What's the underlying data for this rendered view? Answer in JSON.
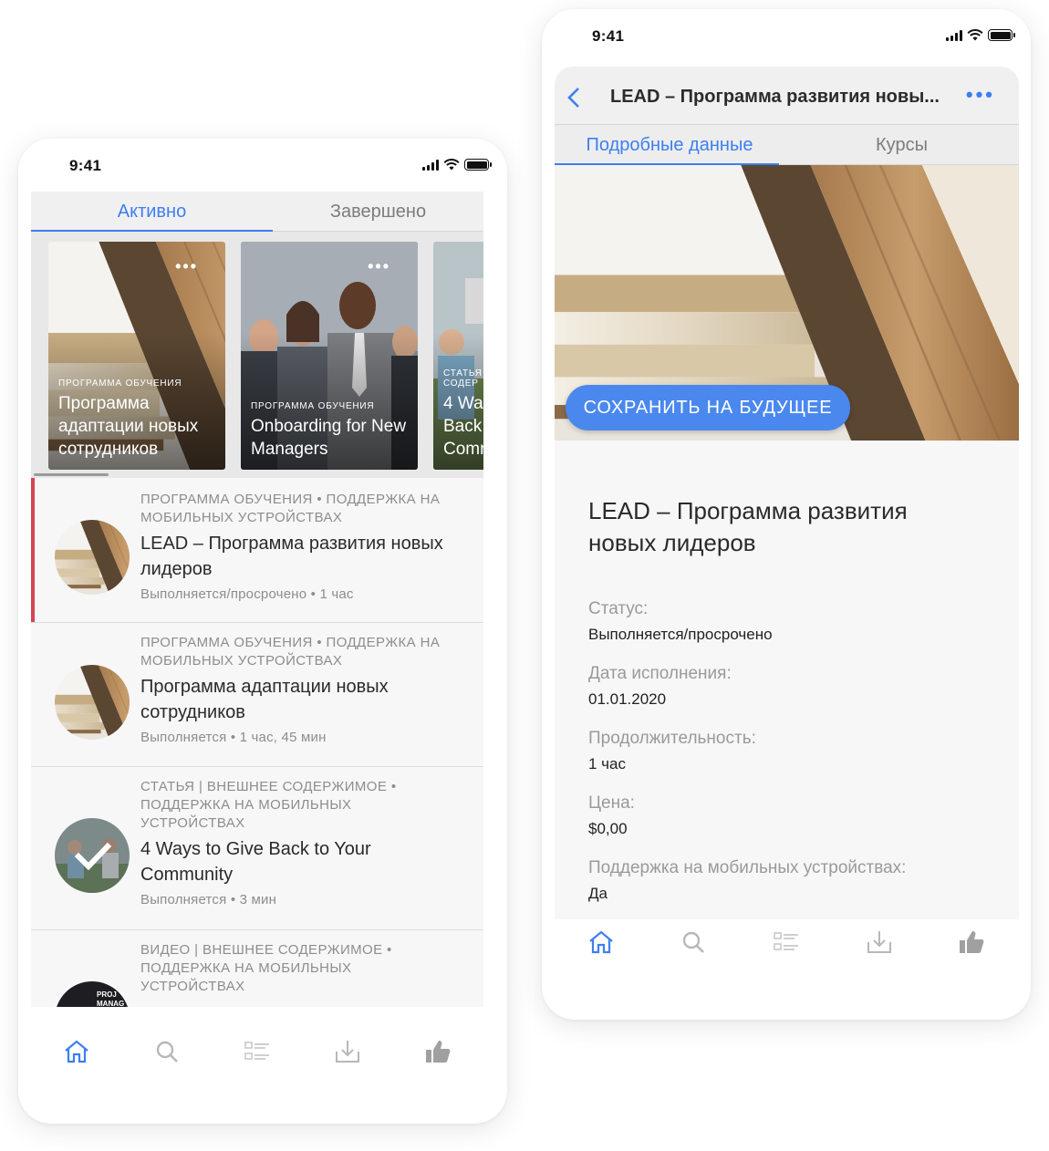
{
  "status_time": "9:41",
  "left_screen": {
    "tabs": [
      {
        "label": "Активно",
        "active": true
      },
      {
        "label": "Завершено",
        "active": false
      }
    ],
    "carousel": [
      {
        "kicker": "ПРОГРАММА ОБУЧЕНИЯ",
        "title": "Программа адаптации новых сотрудников",
        "menu_icon": "more-dots-icon"
      },
      {
        "kicker": "ПРОГРАММА ОБУЧЕНИЯ",
        "title": "Onboarding for New Managers",
        "menu_icon": "more-dots-icon"
      },
      {
        "kicker": "СТАТЬЯ | СОДЕР",
        "title": "4 Wa Back Comr"
      }
    ],
    "list": [
      {
        "meta": "ПРОГРАММА ОБУЧЕНИЯ • ПОДДЕРЖКА НА МОБИЛЬНЫХ УСТРОЙСТВАХ",
        "title": "LEAD – Программа развития новых лидеров",
        "status": "Выполняется/просрочено • 1 час",
        "overdue": true
      },
      {
        "meta": "ПРОГРАММА ОБУЧЕНИЯ • ПОДДЕРЖКА НА МОБИЛЬНЫХ УСТРОЙСТВАХ",
        "title": "Программа адаптации новых сотрудников",
        "status": "Выполняется • 1 час, 45 мин",
        "overdue": false
      },
      {
        "meta": "СТАТЬЯ | ВНЕШНЕЕ СОДЕРЖИМОЕ • ПОДДЕРЖКА НА МОБИЛЬНЫХ УСТРОЙСТВАХ",
        "title": "4 Ways to Give Back to Your Community",
        "status": "Выполняется • 3 мин",
        "overdue": false,
        "completed": true
      },
      {
        "meta": "ВИДЕО | ВНЕШНЕЕ СОДЕРЖИМОЕ • ПОДДЕРЖКА НА МОБИЛЬНЫХ УСТРОЙСТВАХ",
        "title": "",
        "status": "",
        "thumb_text": "PROJ MANAG"
      }
    ]
  },
  "right_screen": {
    "nav_title": "LEAD – Программа развития новы...",
    "tabs": [
      {
        "label": "Подробные данные",
        "active": true
      },
      {
        "label": "Курсы",
        "active": false
      }
    ],
    "save_button": "СОХРАНИТЬ НА БУДУЩЕЕ",
    "title": "LEAD – Программа развития новых лидеров",
    "fields": [
      {
        "label": "Статус:",
        "value": "Выполняется/просрочено"
      },
      {
        "label": "Дата исполнения:",
        "value": "01.01.2020"
      },
      {
        "label": "Продолжительность:",
        "value": "1 час"
      },
      {
        "label": "Цена:",
        "value": "$0,00"
      },
      {
        "label": "Поддержка на мобильных устройствах:",
        "value": "Да"
      }
    ]
  },
  "tabbar": {
    "items": [
      "home-icon",
      "search-icon",
      "list-icon",
      "download-icon",
      "thumbs-up-icon"
    ],
    "active_index": 0
  },
  "colors": {
    "accent": "#3d7ff0",
    "overdue": "#d64550",
    "inactive_icon": "#b8b8b8"
  }
}
